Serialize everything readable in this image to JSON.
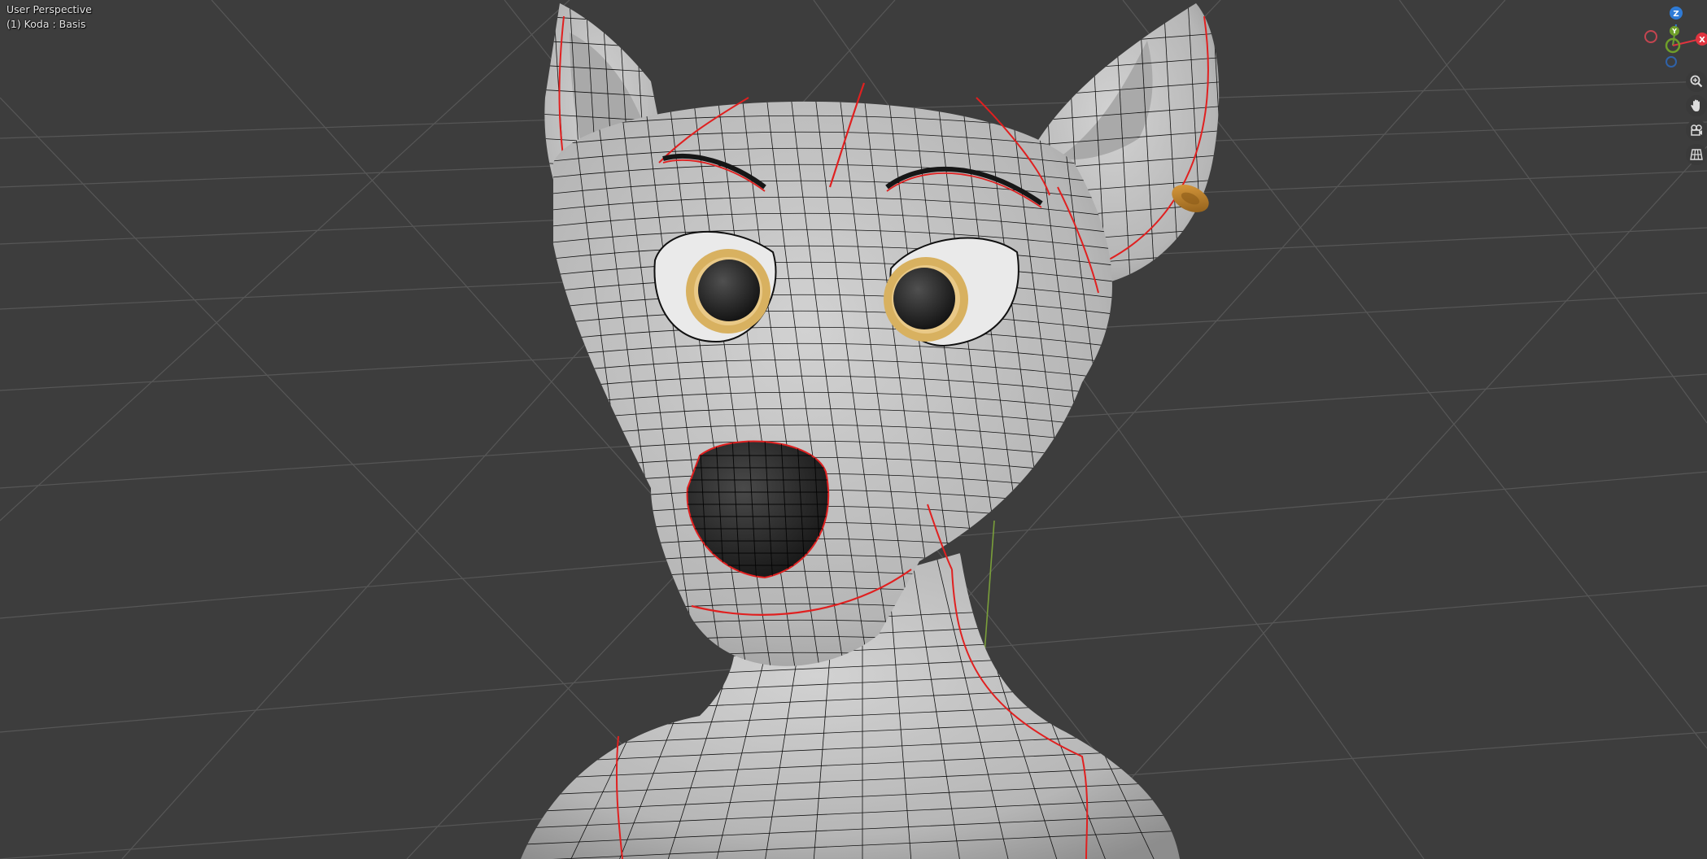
{
  "viewport": {
    "view_name": "User Perspective",
    "object_info": "(1) Koda : Basis",
    "background_color": "#3d3d3d",
    "grid_color": "#575757",
    "mesh_color": "#bdbdbd",
    "wire_color": "#0a0a0a",
    "seam_color": "#e02020",
    "iris_color": "#d8b160",
    "earring_color": "#c88a2a",
    "y_axis_line_color": "#7a9f3a"
  },
  "navigation_gizmo": {
    "axes": [
      {
        "label": "Z",
        "color": "#2f7bd6"
      },
      {
        "label": "Y",
        "color": "#6f9f2a"
      },
      {
        "label": "X",
        "color": "#e0343f"
      }
    ]
  },
  "navigation_buttons": [
    {
      "name": "zoom",
      "icon": "zoom-icon"
    },
    {
      "name": "pan",
      "icon": "hand-icon"
    },
    {
      "name": "camera",
      "icon": "camera-icon"
    },
    {
      "name": "ortho",
      "icon": "grid-icon"
    }
  ]
}
